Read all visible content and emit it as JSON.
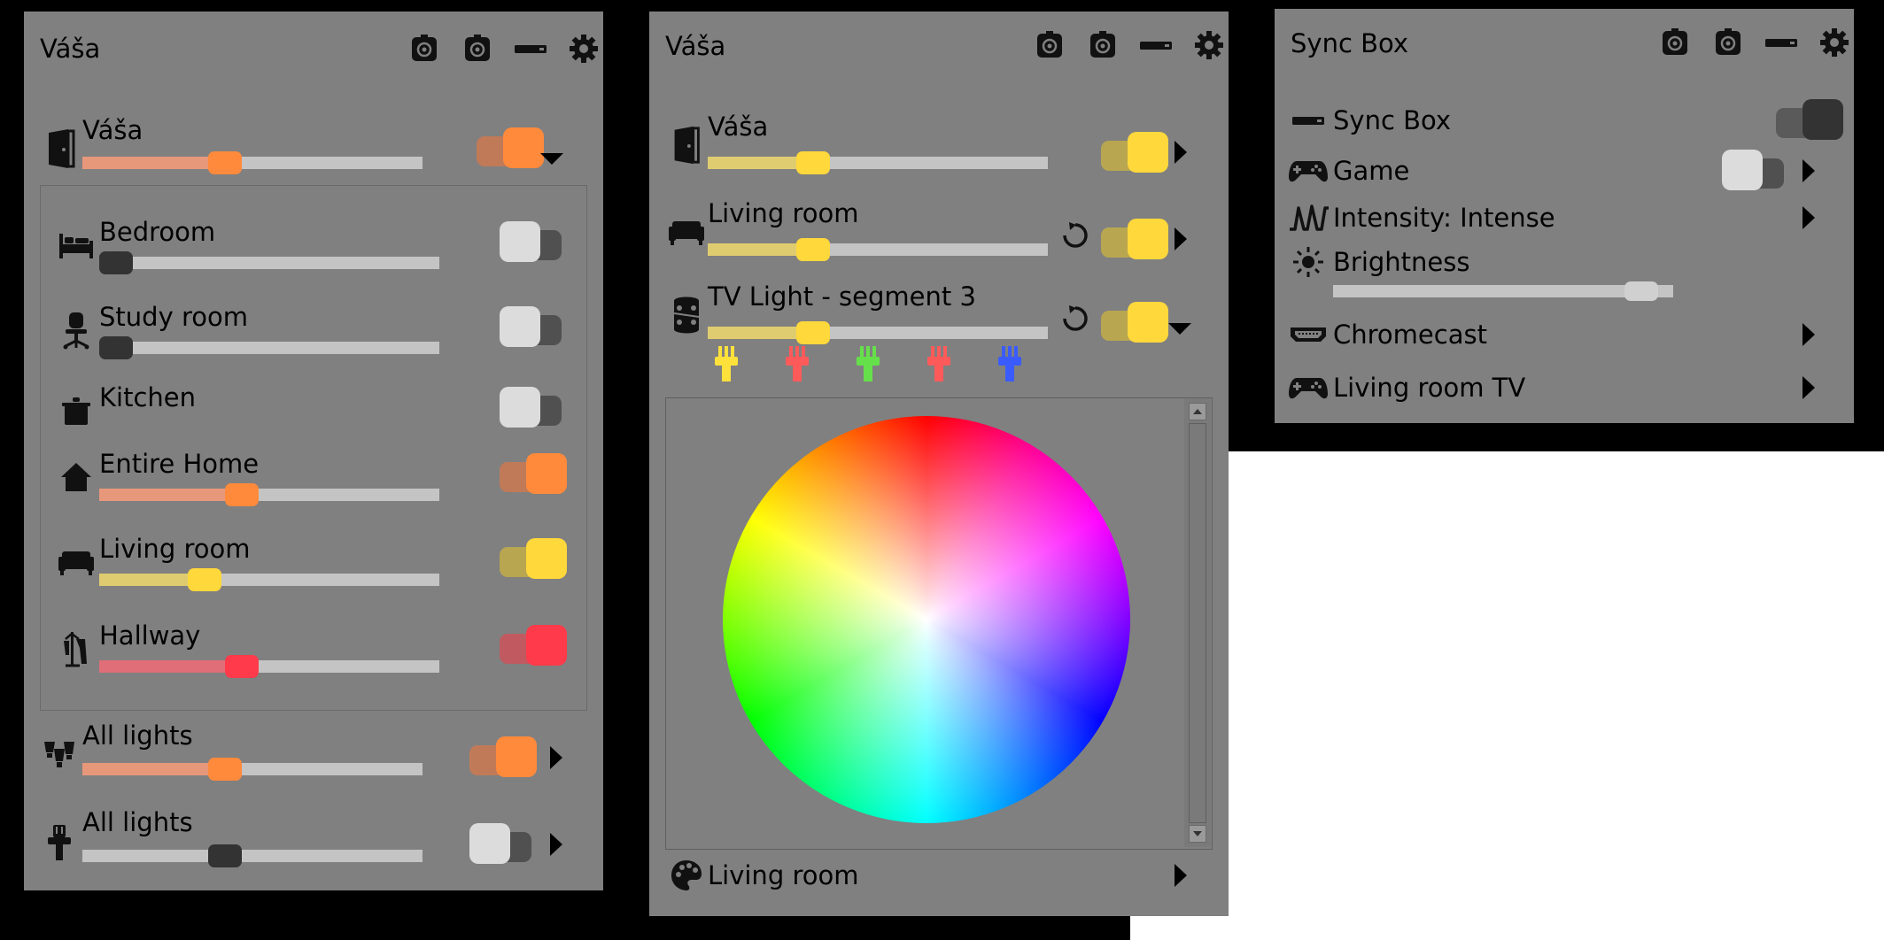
{
  "colors": {
    "panel_bg": "#808080",
    "frame": "#000000",
    "orange": "#ff8a3c",
    "orange_fill": "#e8987a",
    "yellow": "#ffd83c",
    "yellow_fill": "#e0cc70",
    "red": "#ff3a4a",
    "red_fill": "#e06e78",
    "off_thumb": "#dcdcdc",
    "off_track": "#505050",
    "dark_knob": "#333333"
  },
  "header_icons": [
    "hue-bridge-icon",
    "hue-bridge-icon",
    "sync-box-icon",
    "gear-icon"
  ],
  "panel1": {
    "title": "Váša",
    "group": {
      "name": "Váša",
      "icon": "door-icon",
      "brightness": 0.41,
      "on": true,
      "color": "orange",
      "expanded": true
    },
    "rooms": [
      {
        "name": "Bedroom",
        "icon": "bed-icon",
        "brightness": 0.0,
        "on": false,
        "color": "off"
      },
      {
        "name": "Study room",
        "icon": "office-chair-icon",
        "brightness": 0.0,
        "on": false,
        "color": "off"
      },
      {
        "name": "Kitchen",
        "icon": "pot-icon",
        "on": false,
        "color": "off"
      },
      {
        "name": "Entire Home",
        "icon": "home-icon",
        "brightness": 0.41,
        "on": true,
        "color": "orange"
      },
      {
        "name": "Living room",
        "icon": "sofa-icon",
        "brightness": 0.29,
        "on": true,
        "color": "yellow"
      },
      {
        "name": "Hallway",
        "icon": "coat-rack-icon",
        "brightness": 0.41,
        "on": true,
        "color": "red"
      }
    ],
    "footer": [
      {
        "name": "All lights",
        "icon": "bulbs-icon",
        "brightness": 0.41,
        "on": true,
        "color": "orange"
      },
      {
        "name": "All lights",
        "icon": "light-strip-icon",
        "brightness": 0.41,
        "on": false,
        "color": "off"
      }
    ]
  },
  "panel2": {
    "title": "Váša",
    "items": [
      {
        "name": "Váša",
        "icon": "door-icon",
        "brightness": 0.29,
        "on": true,
        "color": "yellow",
        "refresh": false,
        "chevron": "right"
      },
      {
        "name": "Living room",
        "icon": "sofa-icon",
        "brightness": 0.29,
        "on": true,
        "color": "yellow",
        "refresh": true,
        "chevron": "right"
      },
      {
        "name": "TV Light - segment 3",
        "icon": "light-strip-icon",
        "brightness": 0.29,
        "on": true,
        "color": "yellow",
        "refresh": true,
        "chevron": "down"
      }
    ],
    "brush_colors": [
      "#ffe13c",
      "#ff5a5a",
      "#66e04a",
      "#ff5a5a",
      "#3a5cff"
    ],
    "scene": {
      "name": "Living room",
      "icon": "palette-icon"
    }
  },
  "panel3": {
    "title": "Sync Box",
    "items": [
      {
        "name": "Sync Box",
        "icon": "sync-box-icon",
        "type": "toggle",
        "on": false
      },
      {
        "name": "Game",
        "icon": "gamepad-icon",
        "type": "toggle-arrow",
        "on": false
      },
      {
        "name": "Intensity: Intense",
        "icon": "wave-icon",
        "type": "arrow"
      },
      {
        "name": "Brightness",
        "icon": "sun-icon",
        "type": "slider",
        "brightness": 0.95
      },
      {
        "name": "Chromecast",
        "icon": "hdmi-icon",
        "type": "arrow"
      },
      {
        "name": "Living room TV",
        "icon": "gamepad-icon",
        "type": "arrow"
      }
    ]
  }
}
